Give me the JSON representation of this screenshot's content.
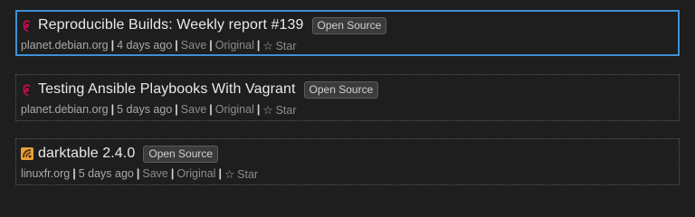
{
  "items": [
    {
      "title": "Reproducible Builds: Weekly report #139",
      "tag": "Open Source",
      "source": "planet.debian.org",
      "age": "4 days ago",
      "save": "Save",
      "original": "Original",
      "star": "Star",
      "favicon": "debian-swirl-icon"
    },
    {
      "title": "Testing Ansible Playbooks With Vagrant",
      "tag": "Open Source",
      "source": "planet.debian.org",
      "age": "5 days ago",
      "save": "Save",
      "original": "Original",
      "star": "Star",
      "favicon": "debian-swirl-icon"
    },
    {
      "title": "darktable 2.4.0",
      "tag": "Open Source",
      "source": "linuxfr.org",
      "age": "5 days ago",
      "save": "Save",
      "original": "Original",
      "star": "Star",
      "favicon": "linuxfr-icon"
    }
  ],
  "colors": {
    "background": "#1e1e1e",
    "selected_border": "#3d8fd6",
    "debian_red": "#d70a53",
    "linuxfr_orange": "#e8a33a"
  }
}
